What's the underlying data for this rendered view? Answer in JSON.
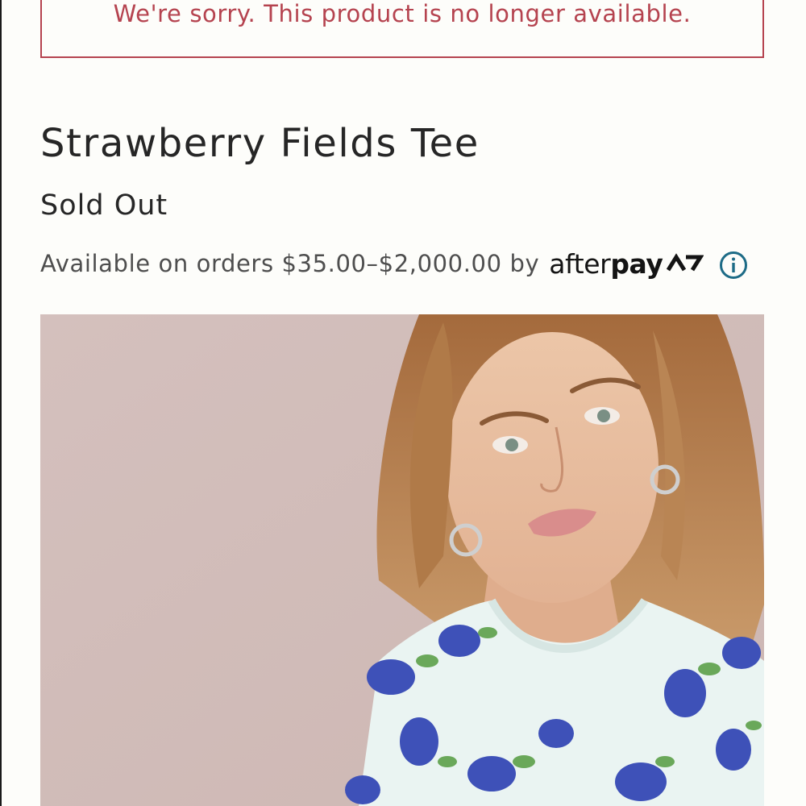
{
  "alert": {
    "message": "We're sorry. This product is no longer available."
  },
  "product": {
    "title": "Strawberry Fields Tee",
    "status": "Sold Out",
    "image_icon": "product-photo"
  },
  "afterpay": {
    "message": "Available on orders $35.00–$2,000.00 by",
    "logo_text_light": "after",
    "logo_text_bold": "pay",
    "info_icon": "info-icon"
  },
  "colors": {
    "alert": "#b5434f",
    "text": "#262626",
    "muted_text": "#4e4e4e",
    "info_accent": "#1d6b86",
    "background": "#fdfdfa",
    "image_backdrop": "#d3bdb9"
  }
}
